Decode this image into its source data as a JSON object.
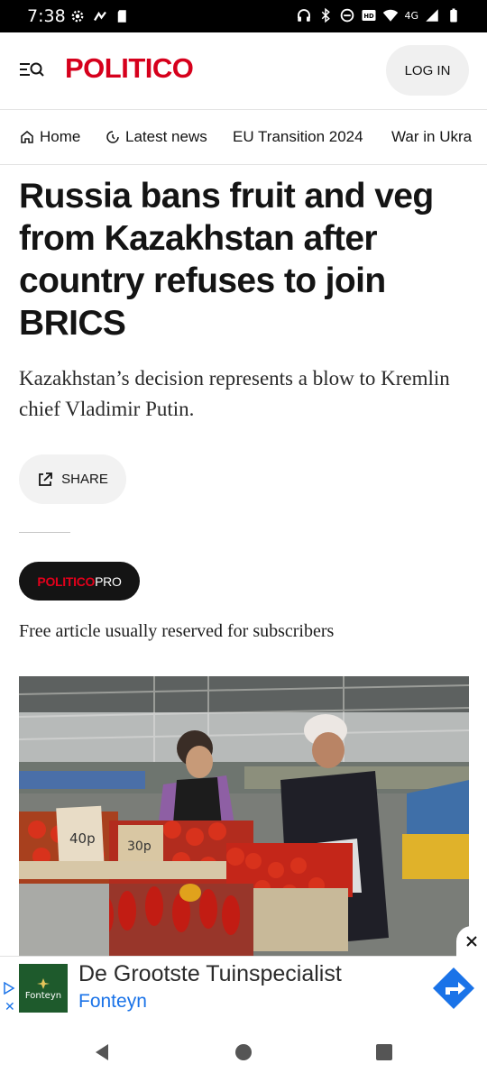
{
  "status_bar": {
    "time": "7:38",
    "network": "4G",
    "left_icons": [
      "settings-icon",
      "cast-icon",
      "sd-card-icon"
    ],
    "right_icons": [
      "headset-icon",
      "bluetooth-icon",
      "dnd-icon",
      "hd-icon",
      "wifi-icon",
      "signal-icon",
      "battery-icon"
    ]
  },
  "header": {
    "logo": "POLITICO",
    "login_label": "LOG IN",
    "menu_icon": "menu-search-icon"
  },
  "nav": {
    "items": [
      {
        "label": "Home",
        "icon": "home-icon"
      },
      {
        "label": "Latest news",
        "icon": "clock-icon"
      },
      {
        "label": "EU Transition 2024",
        "icon": ""
      },
      {
        "label": "War in Ukra",
        "icon": ""
      }
    ]
  },
  "article": {
    "headline": "Russia bans fruit and veg from Kazakhstan after country refuses to join BRICS",
    "dek": "Kazakhstan’s decision represents a blow to Kremlin chief Vladimir Putin.",
    "share_label": "SHARE",
    "badge_brand": "POLITICO",
    "badge_suffix": "PRO",
    "free_note": "Free article usually reserved for subscribers",
    "photo_price_labels": [
      "40р",
      "30р"
    ]
  },
  "ad": {
    "title": "De Grootste Tuinspecialist",
    "advertiser": "Fonteyn",
    "logo_text": "Fonteyn",
    "cta_icon": "directions-icon",
    "close_icon": "close-icon"
  },
  "colors": {
    "brand_red": "#d6001c",
    "link_blue": "#1a73e8",
    "dark": "#141414"
  }
}
